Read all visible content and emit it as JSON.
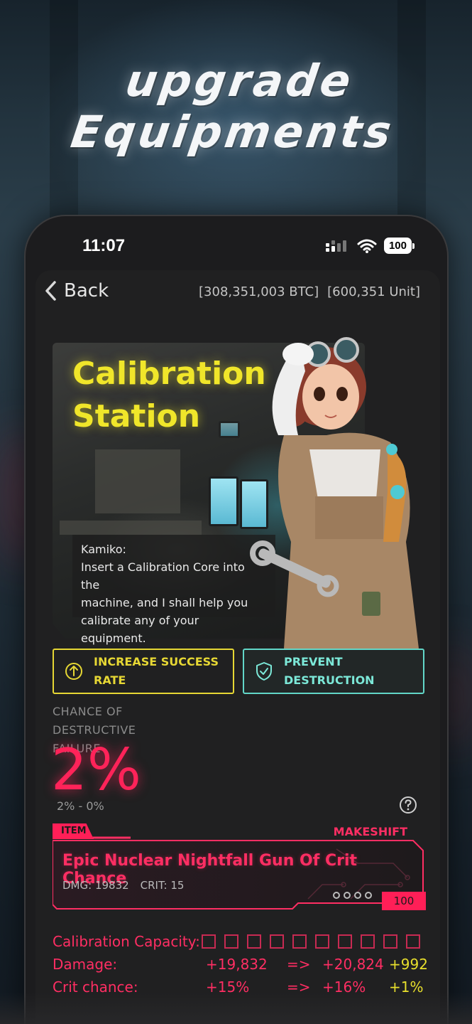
{
  "headline": {
    "line1": "upgrade",
    "line2": "Equipments"
  },
  "status_bar": {
    "time": "11:07",
    "battery": "100"
  },
  "nav": {
    "back_label": "Back",
    "btc_balance": "[308,351,003 BTC]",
    "unit_balance": "[600,351 Unit]"
  },
  "hero": {
    "title_line1": "Calibration",
    "title_line2": "Station",
    "speaker": "Kamiko:",
    "message_line1": "Insert a Calibration Core into the",
    "message_line2": "machine, and I shall help you",
    "message_line3": "calibrate any of your equipment."
  },
  "actions": {
    "increase_success_line1": "INCREASE SUCCESS",
    "increase_success_line2": "RATE",
    "prevent_destruction": "PREVENT DESTRUCTION"
  },
  "failure": {
    "label_line1": "CHANCE OF DESTRUCTIVE",
    "label_line2": "FAILURE",
    "percent": "2%",
    "range": "2% - 0%"
  },
  "item": {
    "tag": "ITEM",
    "rarity": "MAKESHIFT",
    "name": "Epic Nuclear Nightfall Gun Of Crit Chance",
    "dmg": "DMG: 19832",
    "crit": "CRIT: 15",
    "level": "100"
  },
  "stats": {
    "capacity_label": "Calibration Capacity:",
    "capacity_slots": 10,
    "damage": {
      "label": "Damage:",
      "current": "+19,832",
      "arrow": "=>",
      "next": "+20,824",
      "delta": "+992"
    },
    "crit": {
      "label": "Crit chance:",
      "current": "+15%",
      "arrow": "=>",
      "next": "+16%",
      "delta": "+1%"
    }
  },
  "colors": {
    "accent_red": "#ff2e63",
    "accent_yellow": "#e6d734",
    "accent_teal": "#62d6c8"
  }
}
